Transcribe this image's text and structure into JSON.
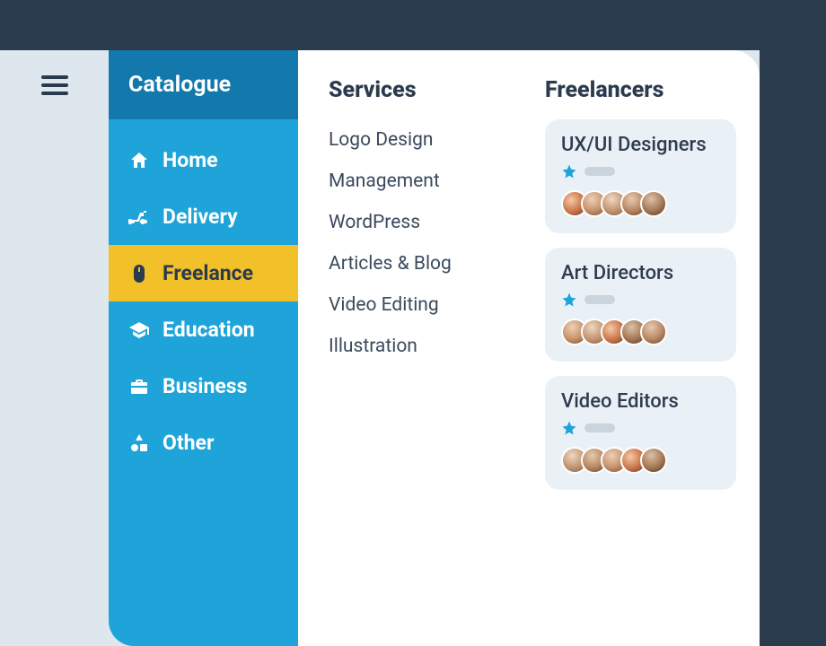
{
  "sidebar": {
    "title": "Catalogue",
    "items": [
      {
        "label": "Home",
        "icon": "home-icon",
        "active": false
      },
      {
        "label": "Delivery",
        "icon": "scooter-icon",
        "active": false
      },
      {
        "label": "Freelance",
        "icon": "mouse-icon",
        "active": true
      },
      {
        "label": "Education",
        "icon": "graduation-icon",
        "active": false
      },
      {
        "label": "Business",
        "icon": "briefcase-icon",
        "active": false
      },
      {
        "label": "Other",
        "icon": "shapes-icon",
        "active": false
      }
    ]
  },
  "content": {
    "services_heading": "Services",
    "services": [
      "Logo Design",
      "Management",
      "WordPress",
      "Articles & Blog",
      "Video Editing",
      "Illustration"
    ],
    "freelancers_heading": "Freelancers",
    "cards": [
      {
        "title": "UX/UI Designers",
        "avatar_count": 5
      },
      {
        "title": "Art Directors",
        "avatar_count": 5
      },
      {
        "title": "Video Editors",
        "avatar_count": 5
      }
    ]
  },
  "colors": {
    "accent_blue": "#1ea4d9",
    "dark_blue": "#1378ac",
    "highlight_yellow": "#f2c029",
    "text_dark": "#2b3b4e"
  }
}
